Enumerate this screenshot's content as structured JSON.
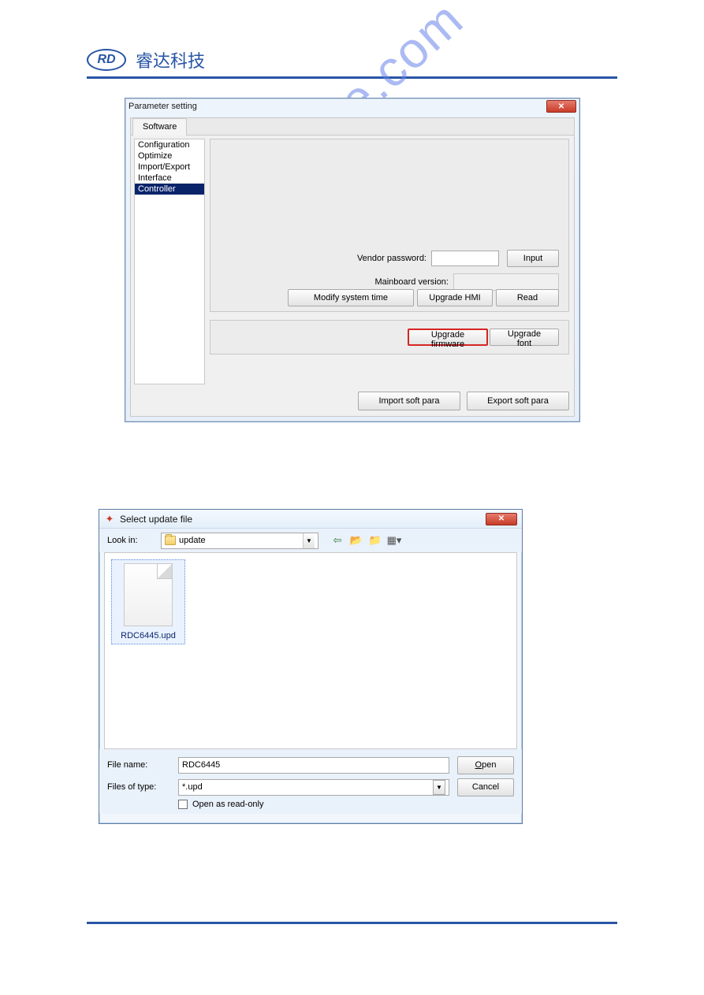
{
  "header": {
    "logo_text": "RD",
    "brand_text": "睿达科技"
  },
  "watermark": "manualshive.com",
  "dialog1": {
    "title": "Parameter setting",
    "tab": "Software",
    "sidebar": {
      "items": [
        "Configuration",
        "Optimize",
        "Import/Export",
        "Interface",
        "Controller"
      ],
      "selected_index": 4
    },
    "vendor_label": "Vendor password:",
    "vendor_value": "",
    "input_btn": "Input",
    "mainboard_label": "Mainboard version:",
    "mainboard_value": "",
    "modify_time_btn": "Modify system time",
    "upgrade_hmi_btn": "Upgrade HMI",
    "read_btn": "Read",
    "upgrade_firmware_btn": "Upgrade firmware",
    "upgrade_font_btn": "Upgrade font",
    "import_para_btn": "Import soft para",
    "export_para_btn": "Export soft para"
  },
  "dialog2": {
    "title": "Select update file",
    "lookin_label": "Look in:",
    "lookin_folder": "update",
    "file_name": "RDC6445.upd",
    "filename_label": "File name:",
    "filename_value": "RDC6445",
    "filetype_label": "Files of type:",
    "filetype_value": "*.upd",
    "open_btn_prefix": "O",
    "open_btn_rest": "pen",
    "cancel_btn": "Cancel",
    "readonly_label": "Open as read-only"
  }
}
